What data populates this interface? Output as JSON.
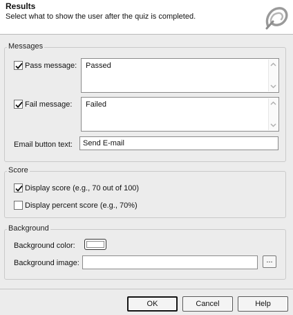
{
  "header": {
    "title": "Results",
    "subtitle": "Select what to show the user after the quiz is completed.",
    "logo_icon": "product-logo-icon"
  },
  "messages": {
    "legend": "Messages",
    "pass": {
      "label": "Pass message:",
      "checked": true,
      "value": "Passed"
    },
    "fail": {
      "label": "Fail message:",
      "checked": true,
      "value": "Failed"
    },
    "email": {
      "label": "Email button text:",
      "value": "Send E-mail"
    }
  },
  "score": {
    "legend": "Score",
    "display_score": {
      "label": "Display score (e.g., 70 out of 100)",
      "checked": true
    },
    "display_percent": {
      "label": "Display percent score (e.g., 70%)",
      "checked": false
    }
  },
  "background": {
    "legend": "Background",
    "color_label": "Background color:",
    "color_value": "#ffffff",
    "image_label": "Background image:",
    "image_value": "",
    "browse_label": "..."
  },
  "buttons": {
    "ok": "OK",
    "cancel": "Cancel",
    "help": "Help"
  }
}
